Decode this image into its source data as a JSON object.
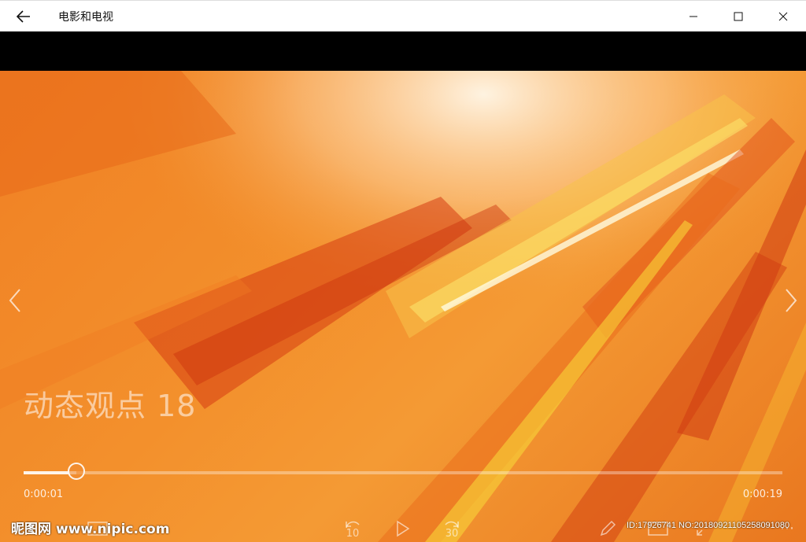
{
  "app": {
    "title": "电影和电视"
  },
  "video": {
    "overlay_title": "动态观点 18",
    "progress": 0.07,
    "current_time": "0:00:01",
    "total_time": "0:00:19",
    "skip_back_label": "10",
    "skip_forward_label": "30"
  },
  "watermark": {
    "brand": "昵图网",
    "site": "www.nipic.com",
    "id_text": "ID:17926741 NO:20180921105258091080"
  },
  "colors": {
    "accent": "#f08024",
    "titlebar_bg": "#ffffff"
  }
}
